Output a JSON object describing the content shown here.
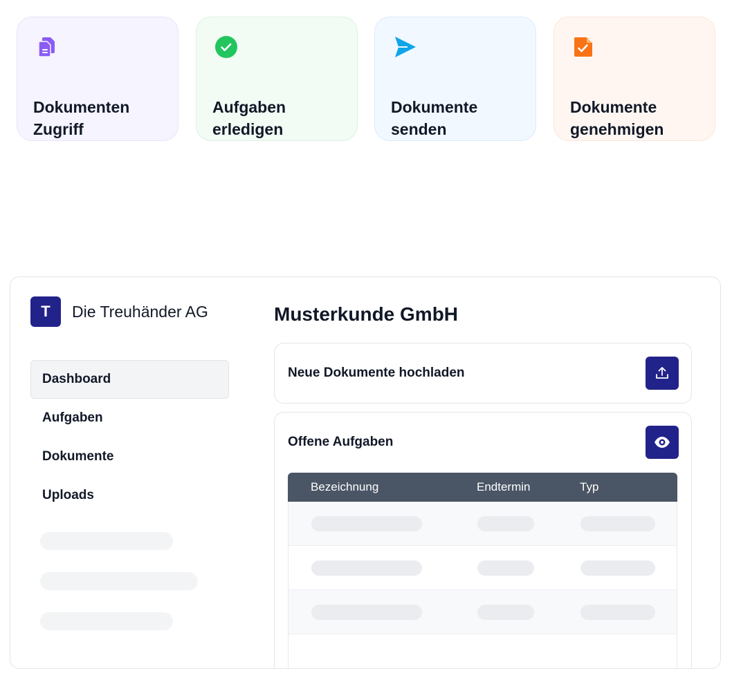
{
  "features": [
    {
      "line1": "Dokumenten",
      "line2": "Zugriff",
      "icon": "documents-icon",
      "color": "#8b5cf6"
    },
    {
      "line1": "Aufgaben",
      "line2": "erledigen",
      "icon": "check-circle-icon",
      "color": "#22c55e"
    },
    {
      "line1": "Dokumente",
      "line2": "senden",
      "icon": "send-icon",
      "color": "#0ea5e9"
    },
    {
      "line1": "Dokumente",
      "line2": "genehmigen",
      "icon": "document-check-icon",
      "color": "#f97316"
    }
  ],
  "app": {
    "brand_initial": "T",
    "brand_name": "Die Treuhänder AG",
    "brand_color": "#22238a",
    "nav": [
      {
        "label": "Dashboard",
        "active": true
      },
      {
        "label": "Aufgaben"
      },
      {
        "label": "Dokumente"
      },
      {
        "label": "Uploads"
      }
    ],
    "title": "Musterkunde GmbH",
    "upload_panel": {
      "label": "Neue Dokumente hochladen",
      "icon": "upload-icon"
    },
    "tasks_panel": {
      "label": "Offene Aufgaben",
      "icon": "eye-icon",
      "columns": [
        "Bezeichnung",
        "Endtermin",
        "Typ"
      ]
    }
  }
}
